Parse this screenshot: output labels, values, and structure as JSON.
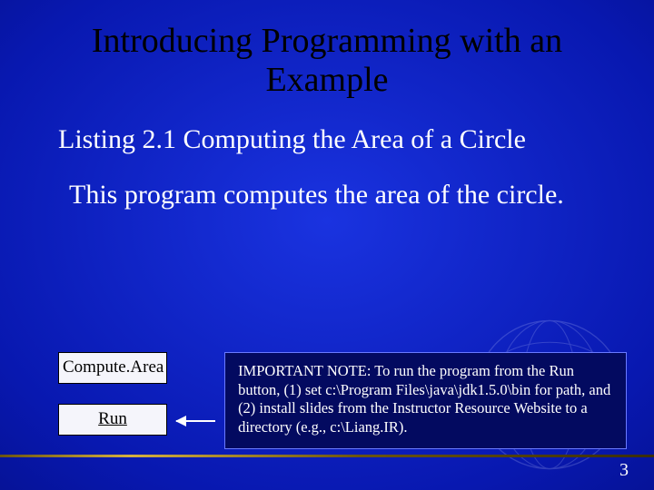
{
  "title": "Introducing Programming with an Example",
  "subtitle": "Listing 2.1 Computing the Area of a Circle",
  "description": "This program computes the area of the circle.",
  "buttons": {
    "compute": "Compute.Area",
    "run": "Run"
  },
  "note": "IMPORTANT NOTE: To run the program from the Run button, (1) set c:\\Program Files\\java\\jdk1.5.0\\bin for path, and (2) install slides from the Instructor Resource Website to a directory (e.g., c:\\Liang.IR).",
  "page_number": "3"
}
